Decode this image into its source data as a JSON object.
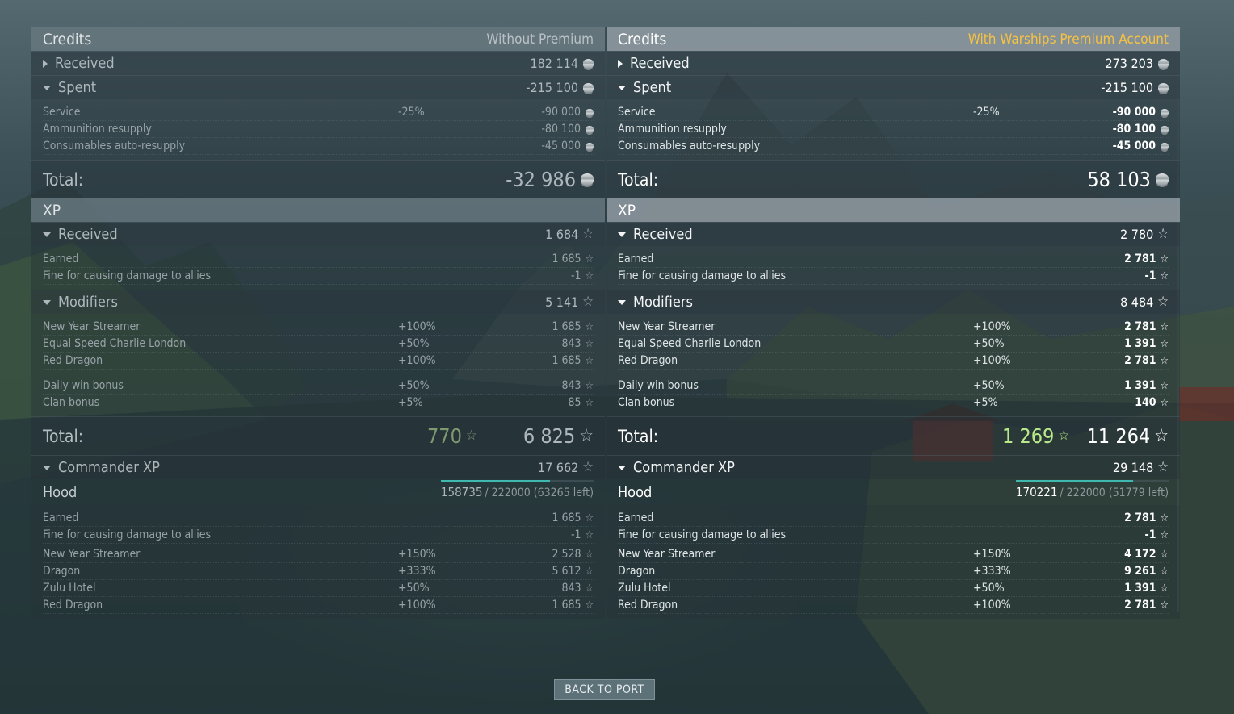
{
  "left": {
    "credits_title": "Credits",
    "credits_subtitle": "Without Premium",
    "received_label": "Received",
    "received_value": "182 114",
    "spent_label": "Spent",
    "spent_value": "-215 100",
    "spent_items": [
      {
        "name": "Service",
        "pct": "-25%",
        "value": "-90 000"
      },
      {
        "name": "Ammunition resupply",
        "pct": "",
        "value": "-80 100"
      },
      {
        "name": "Consumables auto-resupply",
        "pct": "",
        "value": "-45 000"
      }
    ],
    "credits_total_label": "Total:",
    "credits_total_value": "-32 986",
    "xp_title": "XP",
    "xp_received_label": "Received",
    "xp_received_value": "1 684",
    "xp_received_items": [
      {
        "name": "Earned",
        "pct": "",
        "value": "1 685"
      },
      {
        "name": "Fine for causing damage to allies",
        "pct": "",
        "value": "-1"
      }
    ],
    "modifiers_label": "Modifiers",
    "modifiers_value": "5 141",
    "modifiers_items": [
      {
        "name": "New Year Streamer",
        "pct": "+100%",
        "value": "1 685"
      },
      {
        "name": "Equal Speed Charlie London",
        "pct": "+50%",
        "value": "843"
      },
      {
        "name": "Red Dragon",
        "pct": "+100%",
        "value": "1 685"
      }
    ],
    "bonus_items": [
      {
        "name": "Daily win bonus",
        "pct": "+50%",
        "value": "843"
      },
      {
        "name": "Clan bonus",
        "pct": "+5%",
        "value": "85"
      }
    ],
    "xp_total_label": "Total:",
    "xp_total_free": "770",
    "xp_total_value": "6 825",
    "commander_label": "Commander XP",
    "commander_value": "17 662",
    "ship_name": "Hood",
    "ship_progress_current": "158735",
    "ship_progress_rest": "/ 222000 (63265 left)",
    "ship_progress_fraction": 0.715,
    "commander_items": [
      {
        "name": "Earned",
        "pct": "",
        "value": "1 685"
      },
      {
        "name": "Fine for causing damage to allies",
        "pct": "",
        "value": "-1"
      }
    ],
    "commander_mod_items": [
      {
        "name": "New Year Streamer",
        "pct": "+150%",
        "value": "2 528"
      },
      {
        "name": "Dragon",
        "pct": "+333%",
        "value": "5 612"
      },
      {
        "name": "Zulu Hotel",
        "pct": "+50%",
        "value": "843"
      },
      {
        "name": "Red Dragon",
        "pct": "+100%",
        "value": "1 685"
      }
    ]
  },
  "right": {
    "credits_title": "Credits",
    "credits_subtitle": "With Warships Premium Account",
    "received_label": "Received",
    "received_value": "273 203",
    "spent_label": "Spent",
    "spent_value": "-215 100",
    "spent_items": [
      {
        "name": "Service",
        "pct": "-25%",
        "value": "-90 000"
      },
      {
        "name": "Ammunition resupply",
        "pct": "",
        "value": "-80 100"
      },
      {
        "name": "Consumables auto-resupply",
        "pct": "",
        "value": "-45 000"
      }
    ],
    "credits_total_label": "Total:",
    "credits_total_value": "58 103",
    "xp_title": "XP",
    "xp_received_label": "Received",
    "xp_received_value": "2 780",
    "xp_received_items": [
      {
        "name": "Earned",
        "pct": "",
        "value": "2 781"
      },
      {
        "name": "Fine for causing damage to allies",
        "pct": "",
        "value": "-1"
      }
    ],
    "modifiers_label": "Modifiers",
    "modifiers_value": "8 484",
    "modifiers_items": [
      {
        "name": "New Year Streamer",
        "pct": "+100%",
        "value": "2 781"
      },
      {
        "name": "Equal Speed Charlie London",
        "pct": "+50%",
        "value": "1 391"
      },
      {
        "name": "Red Dragon",
        "pct": "+100%",
        "value": "2 781"
      }
    ],
    "bonus_items": [
      {
        "name": "Daily win bonus",
        "pct": "+50%",
        "value": "1 391"
      },
      {
        "name": "Clan bonus",
        "pct": "+5%",
        "value": "140"
      }
    ],
    "xp_total_label": "Total:",
    "xp_total_free": "1 269",
    "xp_total_value": "11 264",
    "commander_label": "Commander XP",
    "commander_value": "29 148",
    "ship_name": "Hood",
    "ship_progress_current": "170221",
    "ship_progress_rest": "/ 222000 (51779 left)",
    "ship_progress_fraction": 0.767,
    "commander_items": [
      {
        "name": "Earned",
        "pct": "",
        "value": "2 781"
      },
      {
        "name": "Fine for causing damage to allies",
        "pct": "",
        "value": "-1"
      }
    ],
    "commander_mod_items": [
      {
        "name": "New Year Streamer",
        "pct": "+150%",
        "value": "4 172"
      },
      {
        "name": "Dragon",
        "pct": "+333%",
        "value": "9 261"
      },
      {
        "name": "Zulu Hotel",
        "pct": "+50%",
        "value": "1 391"
      },
      {
        "name": "Red Dragon",
        "pct": "+100%",
        "value": "2 781"
      }
    ]
  },
  "back_button_label": "BACK TO PORT",
  "icons": {
    "credits": "credits-coin-icon",
    "xp": "xp-star-icon",
    "free_xp": "free-xp-star-icon"
  },
  "colors": {
    "premium_accent": "#f6c241",
    "free_xp_premium": "#b8ea8a",
    "progress": "#3fb9b0"
  }
}
